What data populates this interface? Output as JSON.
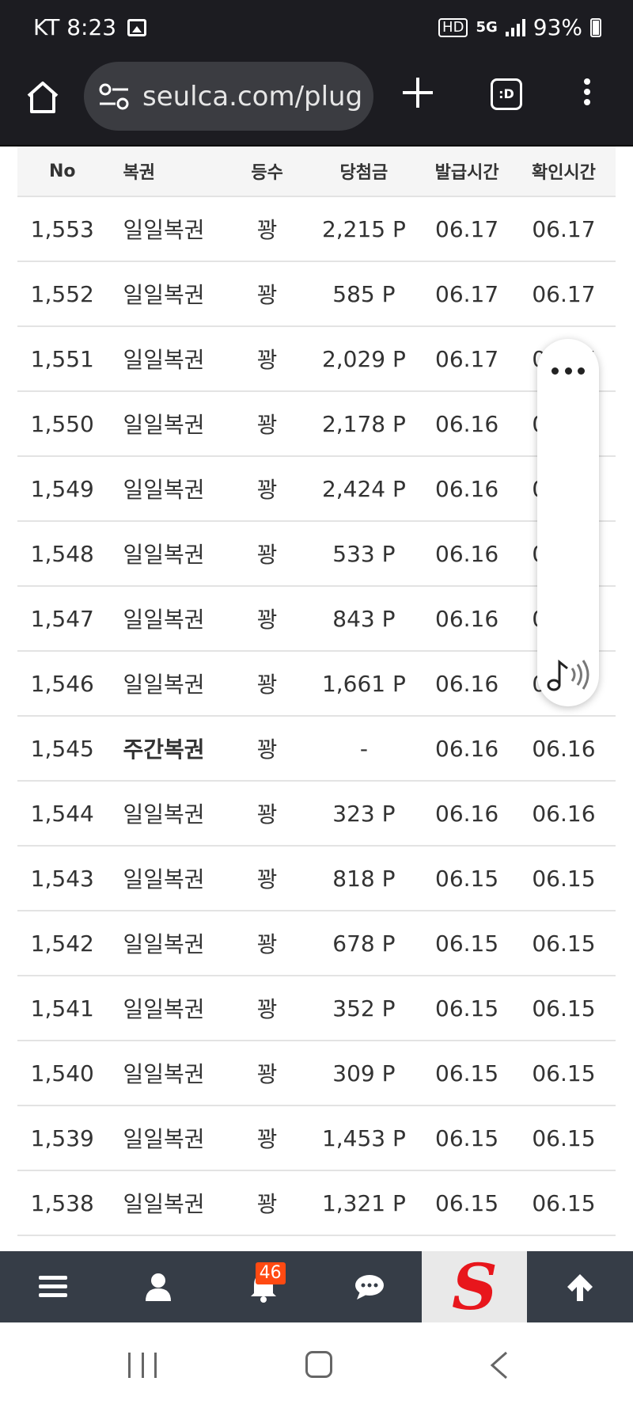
{
  "status_bar": {
    "carrier_time": "KT 8:23",
    "hd": "HD",
    "net": "5G",
    "battery": "93%"
  },
  "browser": {
    "url": "seulca.com/plug",
    "tabs_label": ":D"
  },
  "table": {
    "headers": [
      "No",
      "복권",
      "등수",
      "당첨금",
      "발급시간",
      "확인시간"
    ],
    "rows": [
      {
        "no": "1,553",
        "lottery": "일일복권",
        "rank": "꽝",
        "prize": "2,215 P",
        "issued": "06.17",
        "checked": "06.17"
      },
      {
        "no": "1,552",
        "lottery": "일일복권",
        "rank": "꽝",
        "prize": "585 P",
        "issued": "06.17",
        "checked": "06.17"
      },
      {
        "no": "1,551",
        "lottery": "일일복권",
        "rank": "꽝",
        "prize": "2,029 P",
        "issued": "06.17",
        "checked": "06.17"
      },
      {
        "no": "1,550",
        "lottery": "일일복권",
        "rank": "꽝",
        "prize": "2,178 P",
        "issued": "06.16",
        "checked": "06.16"
      },
      {
        "no": "1,549",
        "lottery": "일일복권",
        "rank": "꽝",
        "prize": "2,424 P",
        "issued": "06.16",
        "checked": "06.16"
      },
      {
        "no": "1,548",
        "lottery": "일일복권",
        "rank": "꽝",
        "prize": "533 P",
        "issued": "06.16",
        "checked": "06.16"
      },
      {
        "no": "1,547",
        "lottery": "일일복권",
        "rank": "꽝",
        "prize": "843 P",
        "issued": "06.16",
        "checked": "06.16"
      },
      {
        "no": "1,546",
        "lottery": "일일복권",
        "rank": "꽝",
        "prize": "1,661 P",
        "issued": "06.16",
        "checked": "06.16"
      },
      {
        "no": "1,545",
        "lottery": "주간복권",
        "rank": "꽝",
        "prize": "-",
        "issued": "06.16",
        "checked": "06.16"
      },
      {
        "no": "1,544",
        "lottery": "일일복권",
        "rank": "꽝",
        "prize": "323 P",
        "issued": "06.16",
        "checked": "06.16"
      },
      {
        "no": "1,543",
        "lottery": "일일복권",
        "rank": "꽝",
        "prize": "818 P",
        "issued": "06.15",
        "checked": "06.15"
      },
      {
        "no": "1,542",
        "lottery": "일일복권",
        "rank": "꽝",
        "prize": "678 P",
        "issued": "06.15",
        "checked": "06.15"
      },
      {
        "no": "1,541",
        "lottery": "일일복권",
        "rank": "꽝",
        "prize": "352 P",
        "issued": "06.15",
        "checked": "06.15"
      },
      {
        "no": "1,540",
        "lottery": "일일복권",
        "rank": "꽝",
        "prize": "309 P",
        "issued": "06.15",
        "checked": "06.15"
      },
      {
        "no": "1,539",
        "lottery": "일일복권",
        "rank": "꽝",
        "prize": "1,453 P",
        "issued": "06.15",
        "checked": "06.15"
      },
      {
        "no": "1,538",
        "lottery": "일일복권",
        "rank": "꽝",
        "prize": "1,321 P",
        "issued": "06.15",
        "checked": "06.15"
      }
    ]
  },
  "app_nav": {
    "notification_count": "46",
    "logo_letter": "S"
  },
  "icons": {
    "home": "home-icon",
    "site_settings": "tune-icon",
    "new_tab": "plus-icon",
    "tabs": "tabs-icon",
    "overflow": "more-vert-icon",
    "floating_more": "more-horiz-icon",
    "floating_music": "music-note-icon",
    "nav_menu": "hamburger-icon",
    "nav_profile": "user-icon",
    "nav_alerts": "bell-icon",
    "nav_chat": "chat-bubble-icon",
    "nav_top": "arrow-up-icon"
  },
  "colors": {
    "system_bar_bg": "#1c1c21",
    "app_nav_bg": "#363d47",
    "badge": "#ff4a12",
    "logo_red": "#e8161c"
  }
}
